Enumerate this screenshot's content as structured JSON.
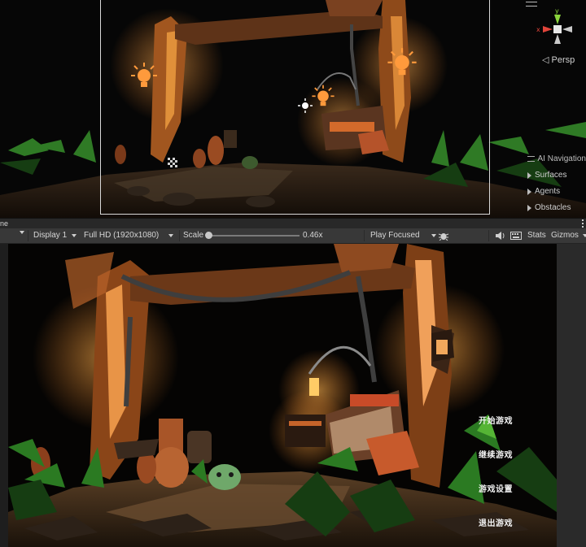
{
  "scene_view": {
    "persp_label": "◁ Persp",
    "gizmo_axes": {
      "x": "x",
      "y": "y"
    },
    "overlay": {
      "title": "AI Navigation",
      "items": [
        "Surfaces",
        "Agents",
        "Obstacles"
      ]
    }
  },
  "game_tab": {
    "label": "ne"
  },
  "game_toolbar": {
    "display": "Display 1",
    "resolution": "Full HD (1920x1080)",
    "scale_label": "Scale",
    "scale_value": "0.46x",
    "scale_fraction": 0.0,
    "play_mode": "Play Focused",
    "stats": "Stats",
    "gizmos": "Gizmos"
  },
  "game_menu": {
    "items": [
      "开始游戏",
      "继续游戏",
      "游戏设置",
      "退出游戏"
    ]
  },
  "colors": {
    "editor_bg": "#383838",
    "frame": "#d9d9d9",
    "torch": "#ff9a3c",
    "axis_x": "#e0443a",
    "axis_y": "#8bd43c",
    "slime": "#6fa86a"
  },
  "icons": [
    "bug-icon",
    "audio-icon",
    "keyboard-icon",
    "light-icon",
    "camera-icon"
  ]
}
